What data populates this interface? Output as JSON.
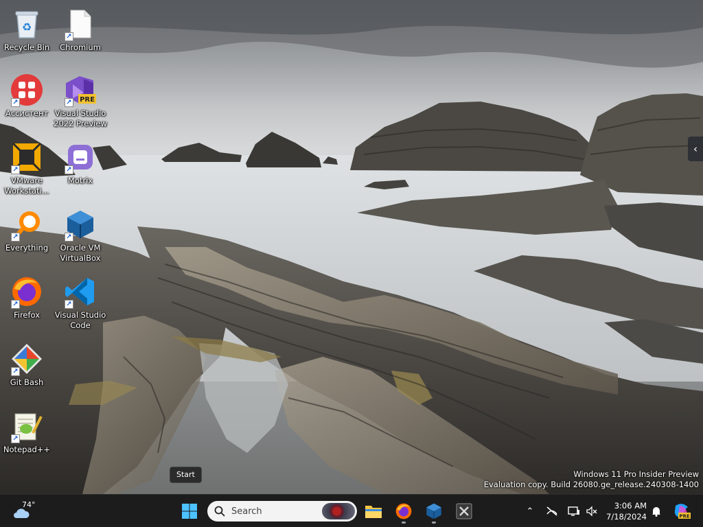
{
  "desktop": {
    "icons": [
      {
        "label": "Recycle Bin",
        "icon": "recycle-bin-icon"
      },
      {
        "label": "Chromium",
        "icon": "file-icon"
      },
      {
        "label": "Ассистент",
        "icon": "assistant-icon"
      },
      {
        "label": "Visual Studio 2022 Preview",
        "icon": "visual-studio-icon",
        "badge": "PRE"
      },
      {
        "label": "VMware Workstati...",
        "icon": "vmware-icon"
      },
      {
        "label": "Motrix",
        "icon": "motrix-icon"
      },
      {
        "label": "Everything",
        "icon": "everything-icon"
      },
      {
        "label": "Oracle VM VirtualBox",
        "icon": "virtualbox-icon"
      },
      {
        "label": "Firefox",
        "icon": "firefox-icon"
      },
      {
        "label": "Visual Studio Code",
        "icon": "vscode-icon"
      },
      {
        "label": "Git Bash",
        "icon": "git-bash-icon"
      },
      {
        "label": "Notepad++",
        "icon": "notepad-plus-plus-icon"
      }
    ]
  },
  "tooltip": {
    "text": "Start"
  },
  "watermark": {
    "line1": "Windows 11 Pro Insider Preview",
    "line2": "Evaluation copy. Build 26080.ge_release.240308-1400"
  },
  "taskbar": {
    "weather": {
      "temp": "74°",
      "icon": "cloud-icon"
    },
    "search": {
      "placeholder": "Search"
    },
    "pinned": [
      {
        "name": "start",
        "icon": "windows-start-icon"
      },
      {
        "name": "file-explorer",
        "icon": "folder-icon"
      },
      {
        "name": "firefox",
        "icon": "firefox-icon"
      },
      {
        "name": "virtualbox",
        "icon": "virtualbox-icon"
      },
      {
        "name": "snipping",
        "icon": "tools-icon"
      }
    ],
    "tray": [
      "chevron-up-icon",
      "network-disconnected-icon",
      "display-icon",
      "speaker-muted-icon"
    ],
    "clock": {
      "time": "3:06 AM",
      "date": "7/18/2024"
    },
    "copilot_badge": "PRE"
  }
}
